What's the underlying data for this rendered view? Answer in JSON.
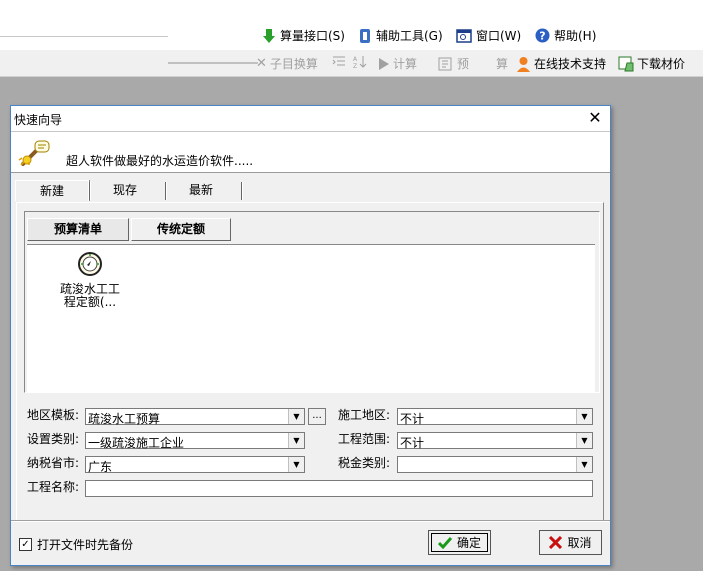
{
  "menubar": {
    "items": [
      {
        "label": "算量接口(S)",
        "icon": "green-arrow-icon"
      },
      {
        "label": "辅助工具(G)",
        "icon": "tools-icon"
      },
      {
        "label": "窗口(W)",
        "icon": "window-icon"
      },
      {
        "label": "帮助(H)",
        "icon": "help-icon"
      }
    ]
  },
  "toolbar": {
    "sub_calc": "子目换算",
    "calc": "计算",
    "pre": "预",
    "suan": "算",
    "online_support": "在线技术支持",
    "download_prices": "下载材价"
  },
  "dialog": {
    "title": "快速向导",
    "banner": "超人软件做最好的水运造价软件.....",
    "tabs": [
      "新建",
      "现存",
      "最新"
    ],
    "subtabs": [
      "预算清单",
      "传统定额"
    ],
    "list_items": [
      {
        "label": "疏浚水工工程定额(..."
      }
    ],
    "form": {
      "region_template_label": "地区模板:",
      "region_template_value": "疏浚水工预算",
      "construction_area_label": "施工地区:",
      "construction_area_value": "不计",
      "setting_type_label": "设置类别:",
      "setting_type_value": "一级疏浚施工企业",
      "project_scope_label": "工程范围:",
      "project_scope_value": "不计",
      "tax_province_label": "纳税省市:",
      "tax_province_value": "广东",
      "tax_type_label": "税金类别:",
      "tax_type_value": "",
      "project_name_label": "工程名称:",
      "project_name_value": ""
    },
    "backup_checkbox_label": "打开文件时先备份",
    "backup_checked": true,
    "ok_label": "确定",
    "cancel_label": "取消"
  },
  "colors": {
    "dialog_border": "#4a84c4",
    "desktop": "#a9a9a9"
  }
}
